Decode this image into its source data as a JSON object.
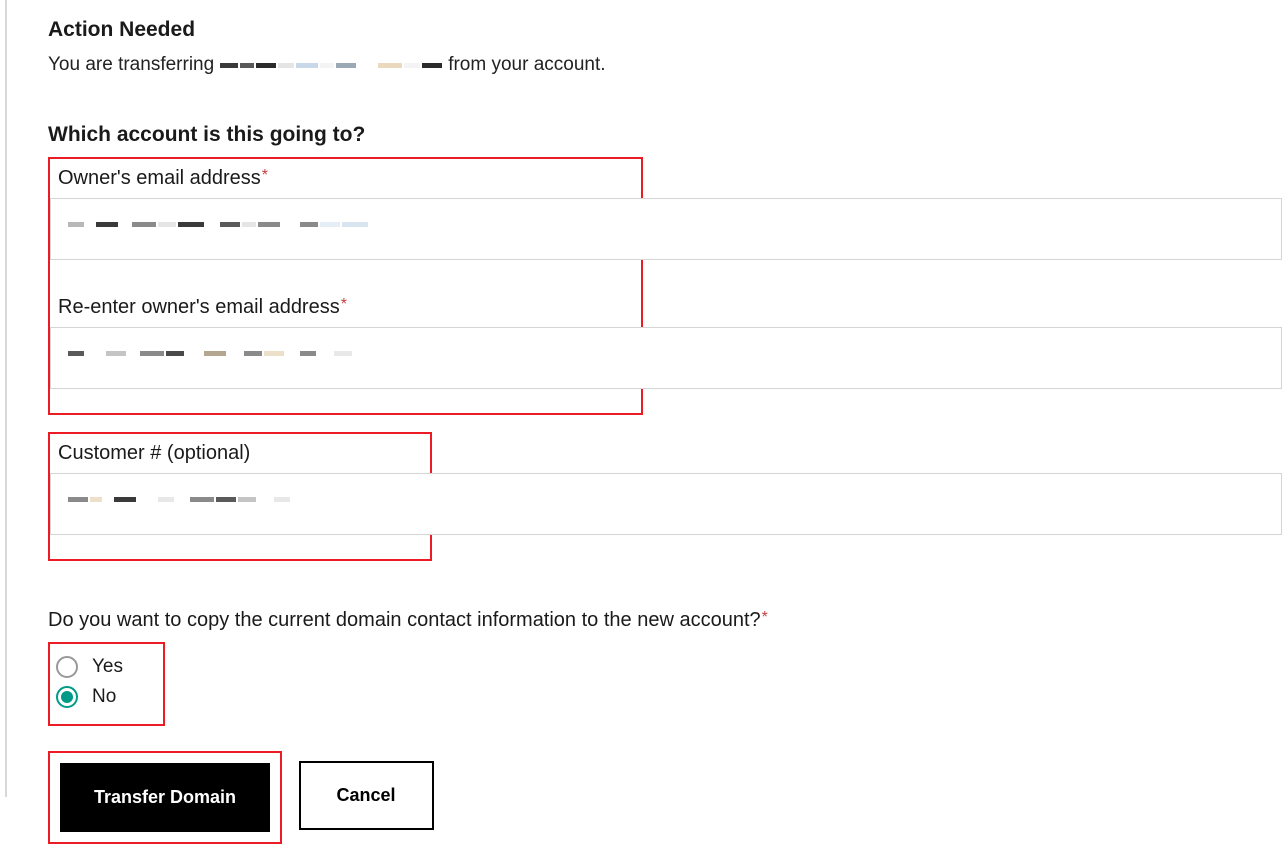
{
  "heading": "Action Needed",
  "subtext_prefix": "You are transferring",
  "subtext_suffix": "from your account.",
  "account_question": "Which account is this going to?",
  "fields": {
    "email": {
      "label": "Owner's email address"
    },
    "reemail": {
      "label": "Re-enter owner's email address"
    },
    "customer": {
      "label": "Customer # (optional)"
    }
  },
  "copy_question": "Do you want to copy the current domain contact information to the new account?",
  "radio": {
    "yes": "Yes",
    "no": "No",
    "selected": "no"
  },
  "buttons": {
    "transfer": "Transfer Domain",
    "cancel": "Cancel"
  }
}
